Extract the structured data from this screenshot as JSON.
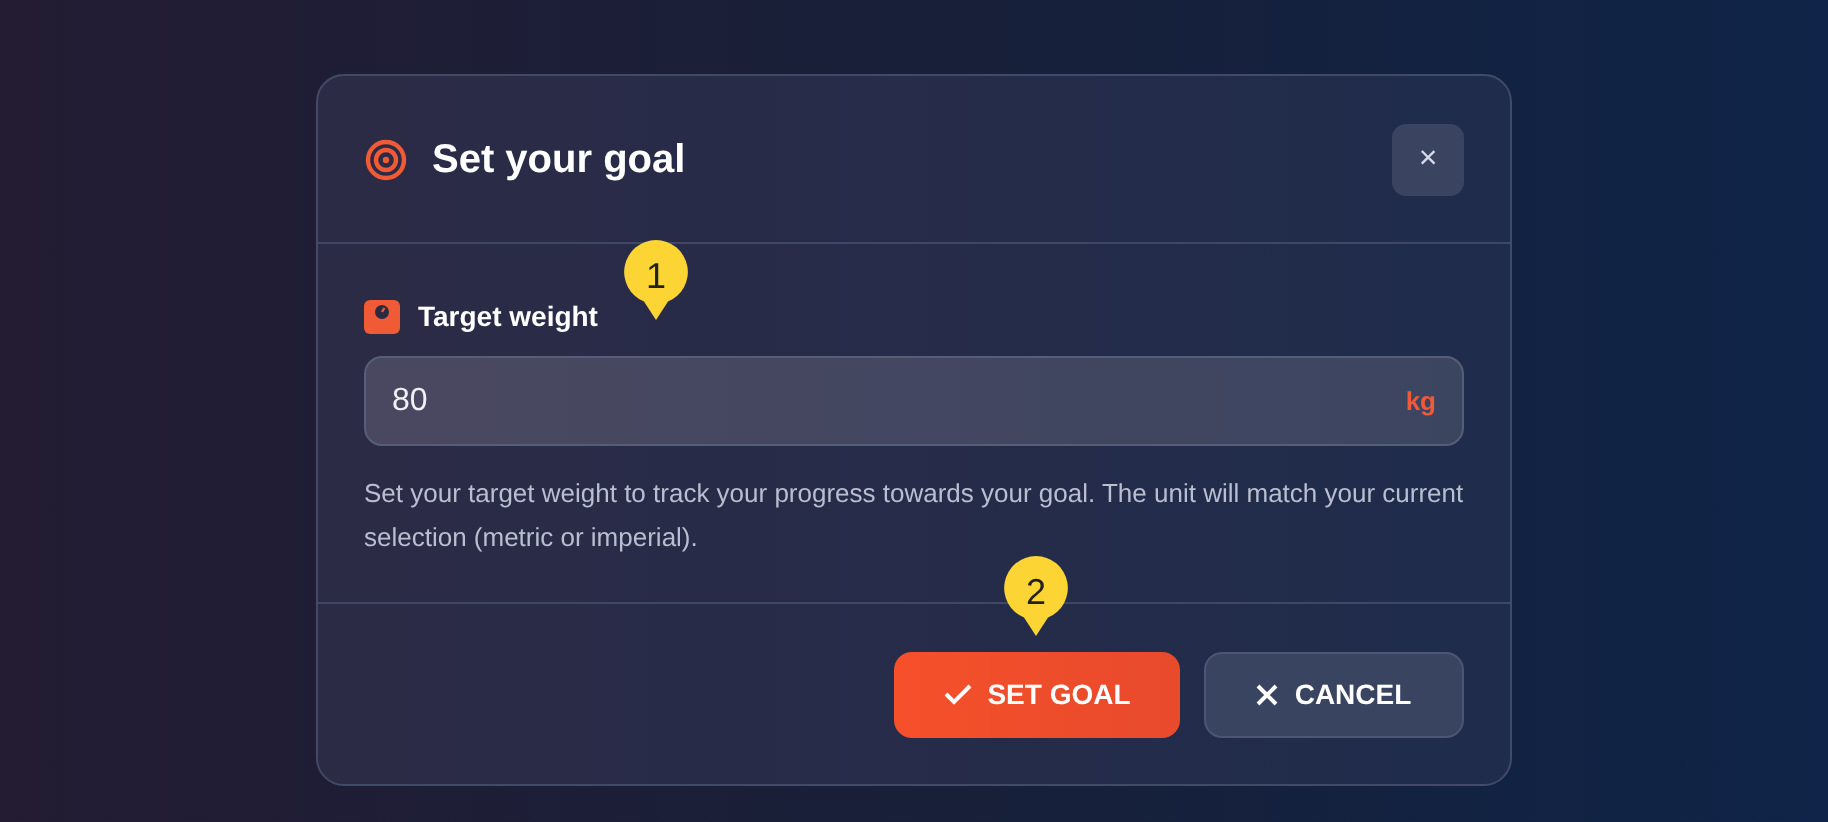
{
  "dialog": {
    "title": "Set your goal",
    "close_label": "×",
    "field": {
      "label": "Target weight",
      "value": "80",
      "unit": "kg",
      "callout": "1"
    },
    "help": "Set your target weight to track your progress towards your goal. The unit will match your current selection (metric or imperial).",
    "buttons": [
      {
        "kind": "primary",
        "label": "SET GOAL",
        "callout": "2"
      },
      {
        "kind": "secondary",
        "label": "CANCEL"
      }
    ]
  }
}
